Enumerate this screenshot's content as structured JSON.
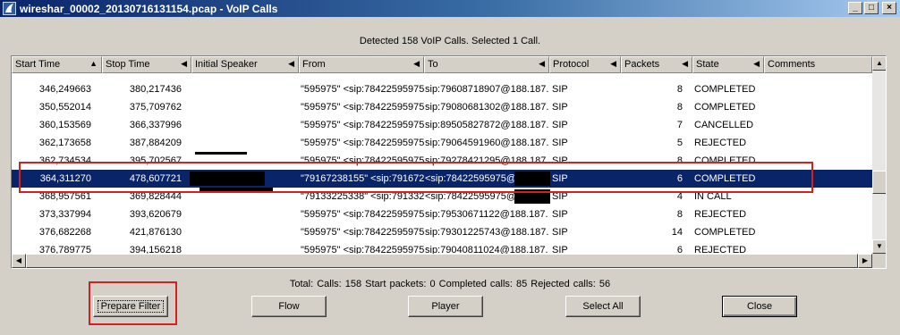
{
  "window": {
    "title": "wireshar_00002_20130716131154.pcap - VoIP Calls",
    "minimize": "_",
    "maximize": "□",
    "close": "×"
  },
  "status_top": "Detected 158 VoIP Calls. Selected 1 Call.",
  "columns": [
    "Start Time",
    "Stop Time",
    "Initial Speaker",
    "From",
    "To",
    "Protocol",
    "Packets",
    "State",
    "Comments"
  ],
  "rows": [
    {
      "start": "346,249663",
      "stop": "380,217436",
      "speaker": "",
      "from": "\"595975\" <sip:78422595975",
      "to": "sip:79608718907@188.187.",
      "protocol": "SIP",
      "packets": "8",
      "state": "COMPLETED",
      "comments": ""
    },
    {
      "start": "350,552014",
      "stop": "375,709762",
      "speaker": "",
      "from": "\"595975\" <sip:78422595975",
      "to": "sip:79080681302@188.187.",
      "protocol": "SIP",
      "packets": "8",
      "state": "COMPLETED",
      "comments": ""
    },
    {
      "start": "360,153569",
      "stop": "366,337996",
      "speaker": "",
      "from": "\"595975\" <sip:78422595975",
      "to": "sip:89505827872@188.187.",
      "protocol": "SIP",
      "packets": "7",
      "state": "CANCELLED",
      "comments": ""
    },
    {
      "start": "362,173658",
      "stop": "387,884209",
      "speaker": "",
      "from": "\"595975\" <sip:78422595975",
      "to": "sip:79064591960@188.187.",
      "protocol": "SIP",
      "packets": "5",
      "state": "REJECTED",
      "comments": ""
    },
    {
      "start": "362,734534",
      "stop": "395,702567",
      "speaker": "",
      "from": "\"595975\" <sip:78422595975",
      "to": "sip:79278421295@188.187.",
      "protocol": "SIP",
      "packets": "8",
      "state": "COMPLETED",
      "comments": ""
    },
    {
      "start": "364,311270",
      "stop": "478,607721",
      "speaker": "",
      "from": "\"79167238155\" <sip:791672",
      "to": "<sip:78422595975@",
      "protocol": "SIP",
      "packets": "6",
      "state": "COMPLETED",
      "comments": "",
      "selected": true
    },
    {
      "start": "368,957561",
      "stop": "369,828444",
      "speaker": "",
      "from": "\"79133225338\" <sip:791332",
      "to": "<sip:78422595975@",
      "protocol": "SIP",
      "packets": "4",
      "state": "IN CALL",
      "comments": ""
    },
    {
      "start": "373,337994",
      "stop": "393,620679",
      "speaker": "",
      "from": "\"595975\" <sip:78422595975",
      "to": "sip:79530671122@188.187.",
      "protocol": "SIP",
      "packets": "8",
      "state": "REJECTED",
      "comments": ""
    },
    {
      "start": "376,682268",
      "stop": "421,876130",
      "speaker": "",
      "from": "\"595975\" <sip:78422595975",
      "to": "sip:79301225743@188.187.",
      "protocol": "SIP",
      "packets": "14",
      "state": "COMPLETED",
      "comments": ""
    },
    {
      "start": "376,789775",
      "stop": "394,156218",
      "speaker": "",
      "from": "\"595975\" <sip:78422595975",
      "to": "sip:79040811024@188.187.",
      "protocol": "SIP",
      "packets": "6",
      "state": "REJECTED",
      "comments": ""
    }
  ],
  "totals": "Total: Calls: 158   Start packets: 0   Completed calls: 85   Rejected calls: 56",
  "buttons": {
    "prepare_filter": "Prepare Filter",
    "flow": "Flow",
    "player": "Player",
    "select_all": "Select All",
    "close": "Close"
  },
  "colors": {
    "selection": "#0a246a",
    "highlight_box": "#d62020",
    "dialog_face": "#d4d0c8"
  },
  "icons": {
    "app": "wireshark-fin-icon",
    "sort": "triangle-up-icon",
    "column_menu": "triangle-left-icon"
  }
}
